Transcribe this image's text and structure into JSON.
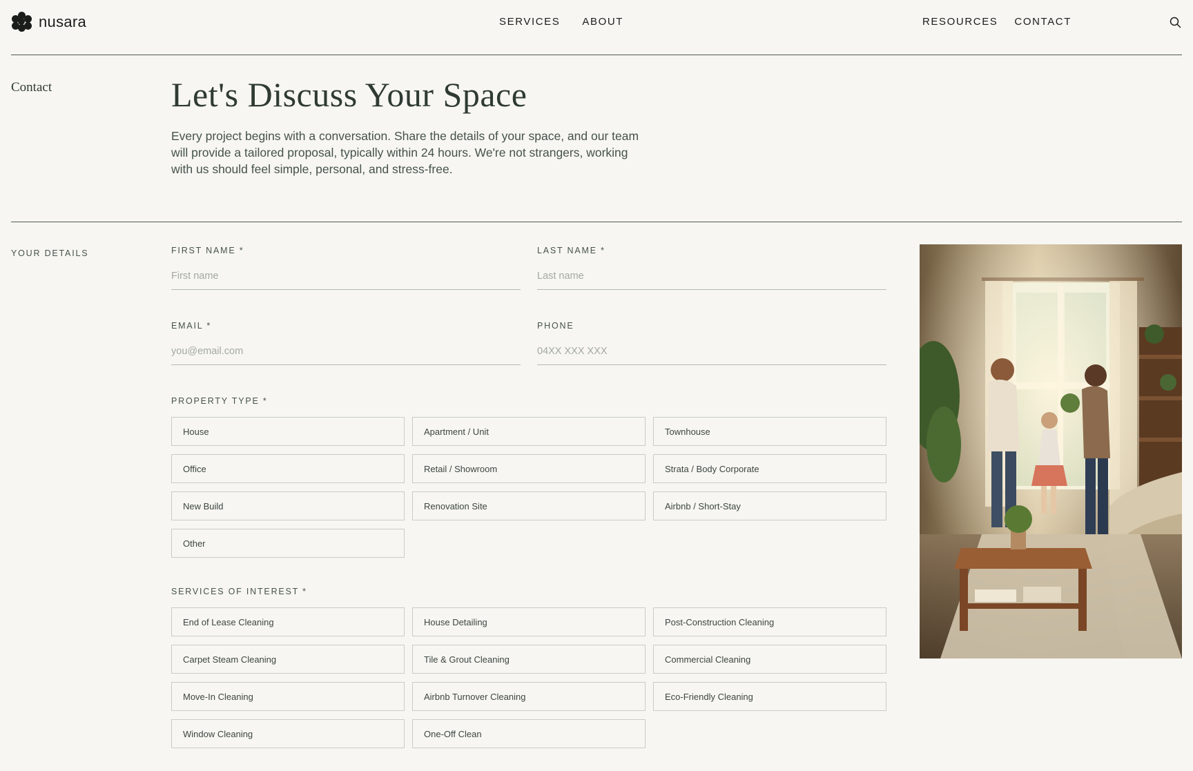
{
  "brand": {
    "name": "nusara"
  },
  "nav": {
    "center": [
      "SERVICES",
      "ABOUT"
    ],
    "right": [
      "RESOURCES",
      "CONTACT"
    ]
  },
  "intro": {
    "section_label": "Contact",
    "title": "Let's Discuss Your Space",
    "body": "Every project begins with a conversation. Share the details of your space, and our team will provide a tailored proposal, typically within 24 hours. We're not strangers, working with us should feel simple, personal, and stress-free."
  },
  "form": {
    "section_label": "YOUR DETAILS",
    "first_name": {
      "label": "FIRST NAME *",
      "placeholder": "First name",
      "value": ""
    },
    "last_name": {
      "label": "LAST NAME *",
      "placeholder": "Last name",
      "value": ""
    },
    "email": {
      "label": "EMAIL *",
      "placeholder": "you@email.com",
      "value": ""
    },
    "phone": {
      "label": "PHONE",
      "placeholder": "04XX XXX XXX",
      "value": ""
    },
    "property_type": {
      "label": "PROPERTY TYPE *",
      "options": [
        "House",
        "Apartment / Unit",
        "Townhouse",
        "Office",
        "Retail / Showroom",
        "Strata / Body Corporate",
        "New Build",
        "Renovation Site",
        "Airbnb / Short-Stay",
        "Other"
      ]
    },
    "services": {
      "label": "SERVICES OF INTEREST *",
      "options": [
        "End of Lease Cleaning",
        "House Detailing",
        "Post-Construction Cleaning",
        "Carpet Steam Cleaning",
        "Tile & Grout Cleaning",
        "Commercial Cleaning",
        "Move-In Cleaning",
        "Airbnb Turnover Cleaning",
        "Eco-Friendly Cleaning",
        "Window Cleaning",
        "One-Off Clean"
      ]
    }
  },
  "colors": {
    "background": "#f7f6f2",
    "text": "#2a302b",
    "heading": "#2f3a33",
    "rule": "#4e5a52",
    "option_border": "#c9ccc8"
  },
  "icons": {
    "search": "search-icon",
    "logo": "nusara-logo-mark"
  }
}
